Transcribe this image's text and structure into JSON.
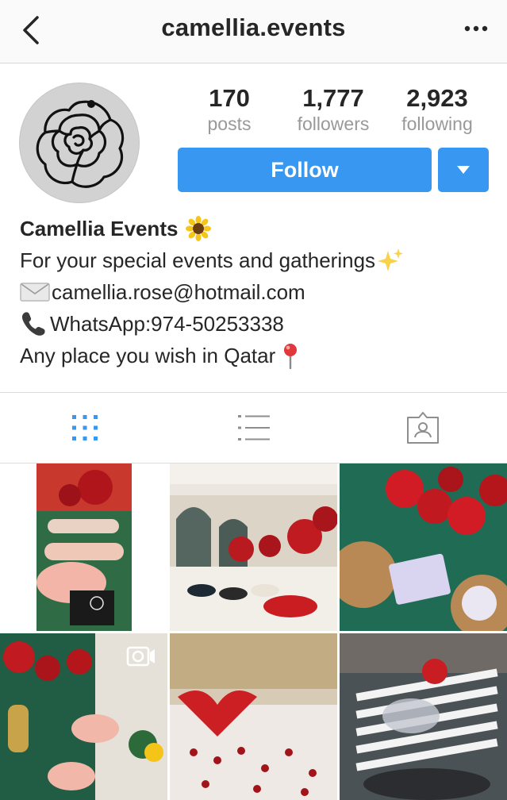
{
  "header": {
    "username": "camellia.events",
    "back_icon": "chevron-left-icon",
    "more_icon": "more-horizontal-icon"
  },
  "stats": [
    {
      "value": "170",
      "label": "posts"
    },
    {
      "value": "1,777",
      "label": "followers"
    },
    {
      "value": "2,923",
      "label": "following"
    }
  ],
  "actions": {
    "follow_label": "Follow",
    "dropdown_icon": "caret-down-icon"
  },
  "bio": {
    "display_name": "Camellia Events",
    "line1": "For your special events and gatherings",
    "email": "camellia.rose@hotmail.com",
    "whatsapp": "WhatsApp:974-50253338",
    "location_line": "Any place you wish in Qatar"
  },
  "tabs": [
    {
      "name": "grid-view",
      "icon": "grid-icon",
      "active": true
    },
    {
      "name": "list-view",
      "icon": "list-icon",
      "active": false
    },
    {
      "name": "tagged",
      "icon": "tagged-person-icon",
      "active": false
    }
  ],
  "posts": [
    {
      "desc": "long table with red flowers",
      "video": false
    },
    {
      "desc": "hall with floor seating",
      "video": false
    },
    {
      "desc": "red roses on green table",
      "video": false
    },
    {
      "desc": "table setting with lanterns",
      "video": true
    },
    {
      "desc": "bed with rose petals",
      "video": false
    },
    {
      "desc": "striped table decor",
      "video": false
    }
  ],
  "colors": {
    "accent": "#3897f0",
    "text": "#262626",
    "muted": "#999999",
    "divider": "#dbdbdb"
  }
}
